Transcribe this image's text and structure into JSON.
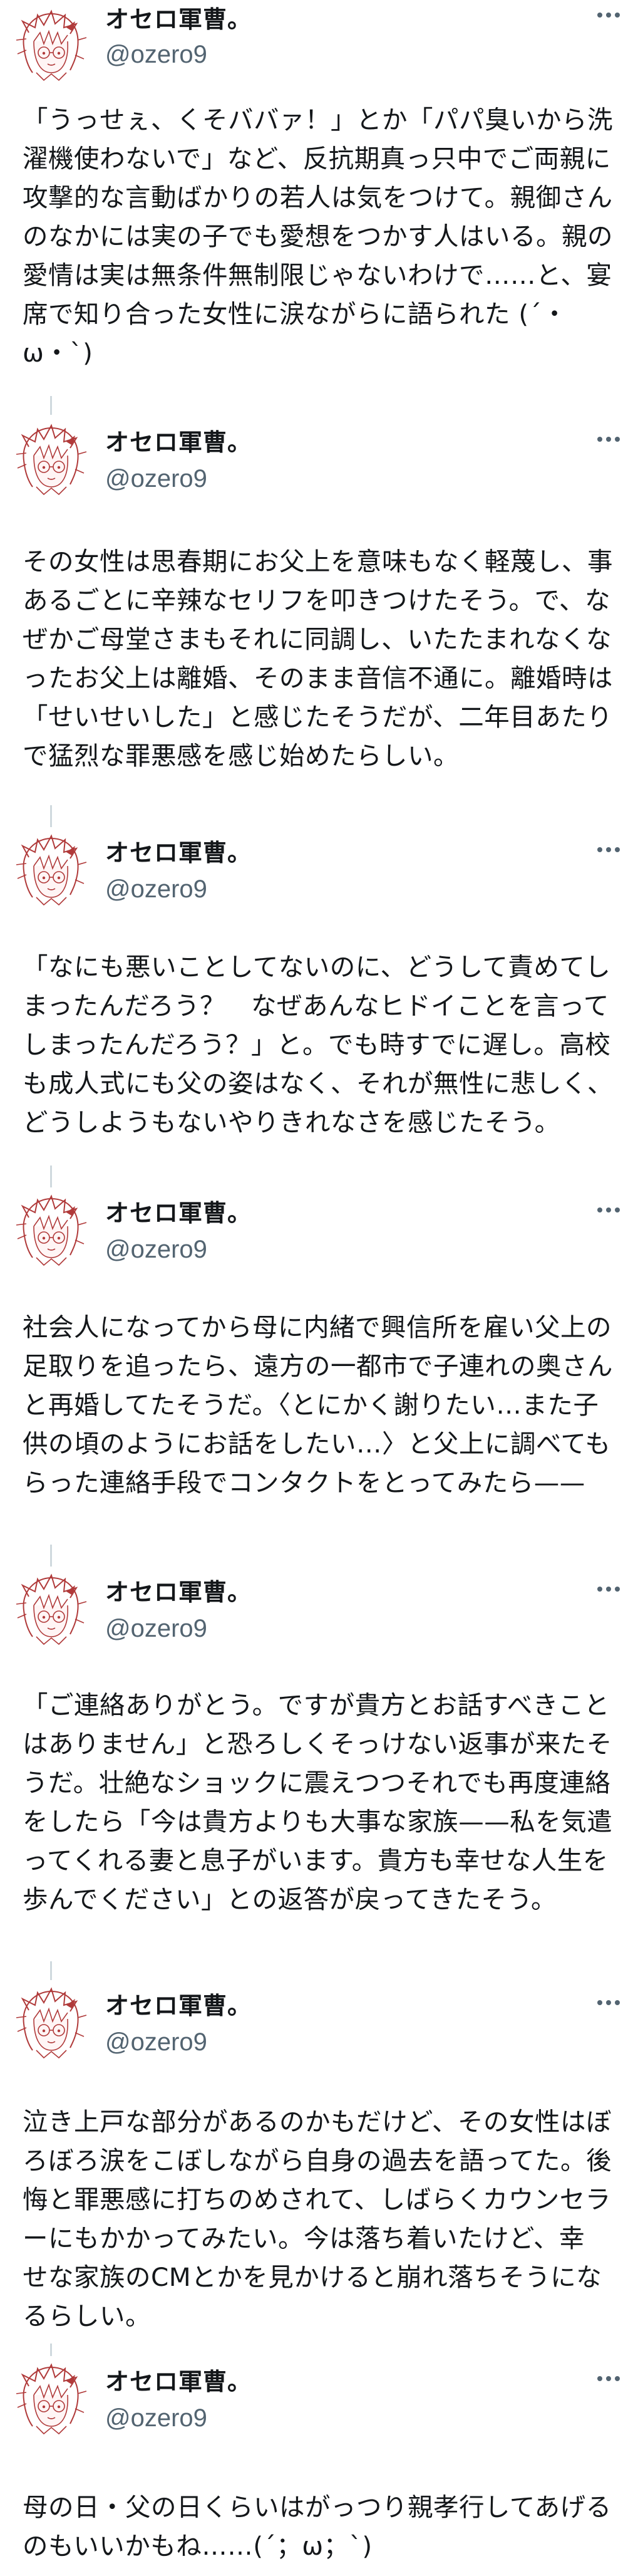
{
  "thread": {
    "author": {
      "name": "オセロ軍曹。",
      "handle": "@ozero9"
    },
    "tweets": [
      {
        "text": "「うっせぇ、くそババァ！」とか「パパ臭いから洗\n濯機使わないで」など、反抗期真っ只中でご両親に\n攻撃的な言動ばかりの若人は気をつけて。親御さん\nのなかには実の子でも愛想をつかす人はいる。親の\n愛情は実は無条件無制限じゃないわけで……と、宴\n席で知り合った女性に涙ながらに語られた (´・\nω・`)"
      },
      {
        "text": "その女性は思春期にお父上を意味もなく軽蔑し、事\nあるごとに辛辣なセリフを叩きつけたそう。で、な\nぜかご母堂さまもそれに同調し、いたたまれなくな\nったお父上は離婚、そのまま音信不通に。離婚時は\n「せいせいした」と感じたそうだが、二年目あたり\nで猛烈な罪悪感を感じ始めたらしい。"
      },
      {
        "text": "「なにも悪いことしてないのに、どうして責めてし\nまったんだろう？　なぜあんなヒドイことを言って\nしまったんだろう？」と。でも時すでに遅し。高校\nも成人式にも父の姿はなく、それが無性に悲しく、\nどうしようもないやりきれなさを感じたそう。"
      },
      {
        "text": "社会人になってから母に内緒で興信所を雇い父上の\n足取りを追ったら、遠方の一都市で子連れの奥さん\nと再婚してたそうだ。〈とにかく謝りたい…また子\n供の頃のようにお話をしたい…〉と父上に調べても\nらった連絡手段でコンタクトをとってみたら——"
      },
      {
        "text": "「ご連絡ありがとう。ですが貴方とお話すべきこと\nはありません」と恐ろしくそっけない返事が来たそ\nうだ。壮絶なショックに震えつつそれでも再度連絡\nをしたら「今は貴方よりも大事な家族——私を気遣\nってくれる妻と息子がいます。貴方も幸せな人生を\n歩んでください」との返答が戻ってきたそう。"
      },
      {
        "text": "泣き上戸な部分があるのかもだけど、その女性はぼ\nろぼろ涙をこぼしながら自身の過去を語ってた。後\n悔と罪悪感に打ちのめされて、しばらくカウンセラ\nーにもかかってみたい。今は落ち着いたけど、幸\nせな家族のCMとかを見かけると崩れ落ちそうにな\nるらしい。"
      },
      {
        "text": "母の日・父の日くらいはがっつり親孝行してあげる\nのもいいかもね……(´；ω；`)"
      }
    ]
  },
  "icons": {
    "more": "more-horizontal-icon",
    "avatar": "avatar-illustration"
  },
  "colors": {
    "text": "#14171a",
    "handle": "#536471",
    "connector": "#cfd9de",
    "avatar_line": "#b03a3a"
  }
}
